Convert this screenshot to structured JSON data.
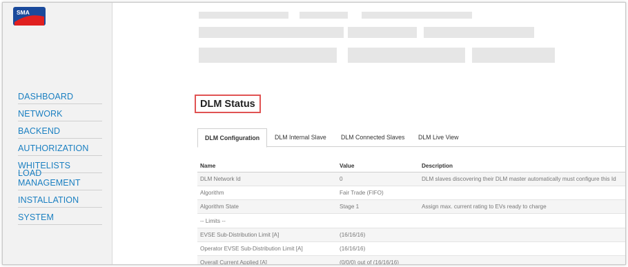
{
  "sidebar": {
    "logo_text": "SMA",
    "items": [
      {
        "label": "DASHBOARD"
      },
      {
        "label": "NETWORK"
      },
      {
        "label": "BACKEND"
      },
      {
        "label": "AUTHORIZATION"
      },
      {
        "label": "WHITELISTS"
      },
      {
        "label": "LOAD MANAGEMENT"
      },
      {
        "label": "INSTALLATION"
      },
      {
        "label": "SYSTEM"
      }
    ]
  },
  "main": {
    "title": "DLM Status",
    "tabs": [
      {
        "label": "DLM Configuration",
        "active": true
      },
      {
        "label": "DLM Internal Slave"
      },
      {
        "label": "DLM Connected Slaves"
      },
      {
        "label": "DLM Live View"
      }
    ],
    "table": {
      "headers": {
        "name": "Name",
        "value": "Value",
        "description": "Description"
      },
      "rows": [
        {
          "name": "DLM Network Id",
          "value": "0",
          "description": "DLM slaves discovering their DLM master automatically must configure this Id"
        },
        {
          "name": "Algorithm",
          "value": "Fair Trade (FIFO)",
          "description": ""
        },
        {
          "name": "Algorithm State",
          "value": "Stage 1",
          "description": "Assign max. current rating to EVs ready to charge"
        },
        {
          "name": "-- Limits --",
          "value": "",
          "description": ""
        },
        {
          "name": "EVSE Sub-Distribution Limit [A]",
          "value": "(16/16/16)",
          "description": ""
        },
        {
          "name": "Operator EVSE Sub-Distribution Limit [A]",
          "value": "(16/16/16)",
          "description": ""
        },
        {
          "name": "Overall Current Applied [A]",
          "value": "(0/0/0) out of (16/16/16)",
          "description": ""
        }
      ]
    }
  },
  "colors": {
    "link": "#1a7fc1",
    "highlight_border": "#e05252",
    "sidebar_bg": "#f2f2f2"
  }
}
